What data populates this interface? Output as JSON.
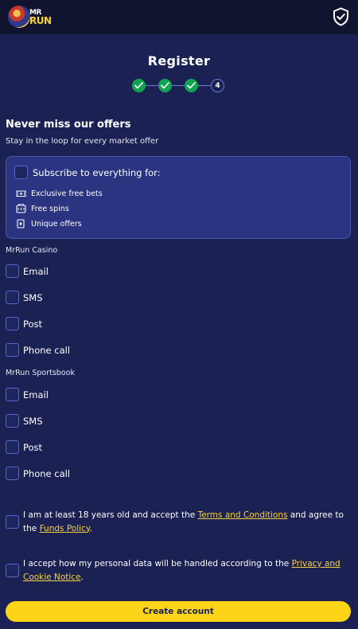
{
  "brand": {
    "logo_top": "MR",
    "logo_bottom": "RUN"
  },
  "page": {
    "title": "Register"
  },
  "stepper": {
    "current_step": "4"
  },
  "offers": {
    "heading": "Never miss our offers",
    "subheading": "Stay in the loop for every market offer",
    "subscribe_all_label": "Subscribe to everything for:",
    "benefits": [
      "Exclusive free bets",
      "Free spins",
      "Unique offers"
    ]
  },
  "casino": {
    "label": "MrRun Casino",
    "options": [
      "Email",
      "SMS",
      "Post",
      "Phone call"
    ]
  },
  "sportsbook": {
    "label": "MrRun Sportsbook",
    "options": [
      "Email",
      "SMS",
      "Post",
      "Phone call"
    ]
  },
  "consents": {
    "age": {
      "text_before": "I am at least 18 years old and accept the ",
      "terms_link": "Terms and Conditions",
      "text_middle": " and agree to the ",
      "funds_link": "Funds Policy",
      "text_after": "."
    },
    "privacy": {
      "text_before": "I accept how my personal data will be handled according to the ",
      "privacy_link": "Privacy and Cookie Notice",
      "text_after": "."
    }
  },
  "cta": {
    "label": "Create account"
  },
  "colors": {
    "background": "#1b2152",
    "accent": "#fcd418",
    "success": "#12a453",
    "link": "#f7d23d"
  }
}
